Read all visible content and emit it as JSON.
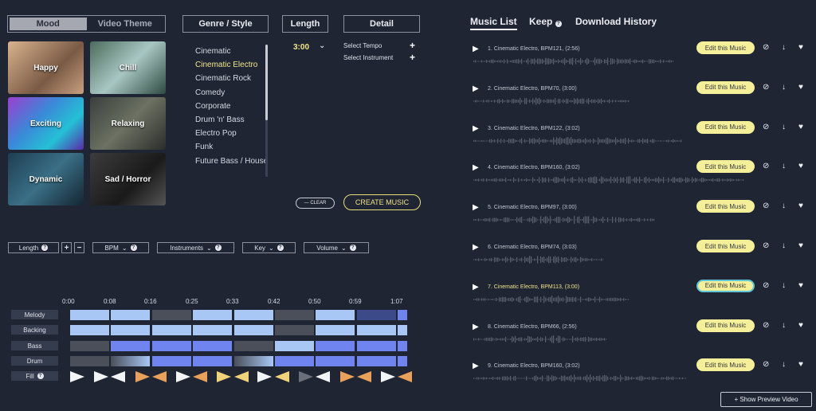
{
  "left": {
    "mood_tabs": [
      "Mood",
      "Video Theme"
    ],
    "mood_tiles": [
      {
        "label": "Happy"
      },
      {
        "label": "Chill"
      },
      {
        "label": "Exciting"
      },
      {
        "label": "Relaxing"
      },
      {
        "label": "Dynamic"
      },
      {
        "label": "Sad / Horror"
      }
    ],
    "genre_header": "Genre / Style",
    "genres": [
      "Cinematic",
      "Cinematic Electro",
      "Cinematic Rock",
      "Comedy",
      "Corporate",
      "Drum 'n' Bass",
      "Electro Pop",
      "Funk",
      "Future Bass / House"
    ],
    "selected_genre": "Cinematic Electro",
    "length_header": "Length",
    "length_value": "3:00",
    "detail_header": "Detail",
    "select_tempo": "Select Tempo",
    "select_instrument": "Select Instrument",
    "clear_label": "— CLEAR",
    "create_label": "CREATE MUSIC",
    "controls": {
      "length": "Length",
      "bpm": "BPM",
      "instruments": "Instruments",
      "key": "Key",
      "volume": "Volume"
    },
    "timeline": [
      "0:00",
      "0:08",
      "0:16",
      "0:25",
      "0:33",
      "0:42",
      "0:50",
      "0:59",
      "1:07"
    ],
    "tracks": [
      "Melody",
      "Backing",
      "Bass",
      "Drum",
      "Fill"
    ]
  },
  "right": {
    "tabs": [
      "Music List",
      "Keep",
      "Download History"
    ],
    "edit_label": "Edit this Music",
    "songs": [
      "1. Cinematic Electro, BPM121, (2:56)",
      "2. Cinematic Electro, BPM70, (3:00)",
      "3. Cinematic Electro, BPM122, (3:02)",
      "4. Cinematic Electro, BPM160, (3:02)",
      "5. Cinematic Electro, BPM97, (3:00)",
      "6. Cinematic Electro, BPM74, (3:03)",
      "7. Cinematic Electro, BPM113, (3:00)",
      "8. Cinematic Electro, BPM66, (2:56)",
      "9. Cinematic Electro, BPM160, (3:02)"
    ],
    "show_preview": "+ Show Preview Video"
  },
  "colors": {
    "accent_yellow": "#f4ef98",
    "block_blue": "#6f84ee",
    "block_light": "#a9c7f5",
    "block_gray": "#4a4f59",
    "fill_orange": "#e8a05a"
  }
}
